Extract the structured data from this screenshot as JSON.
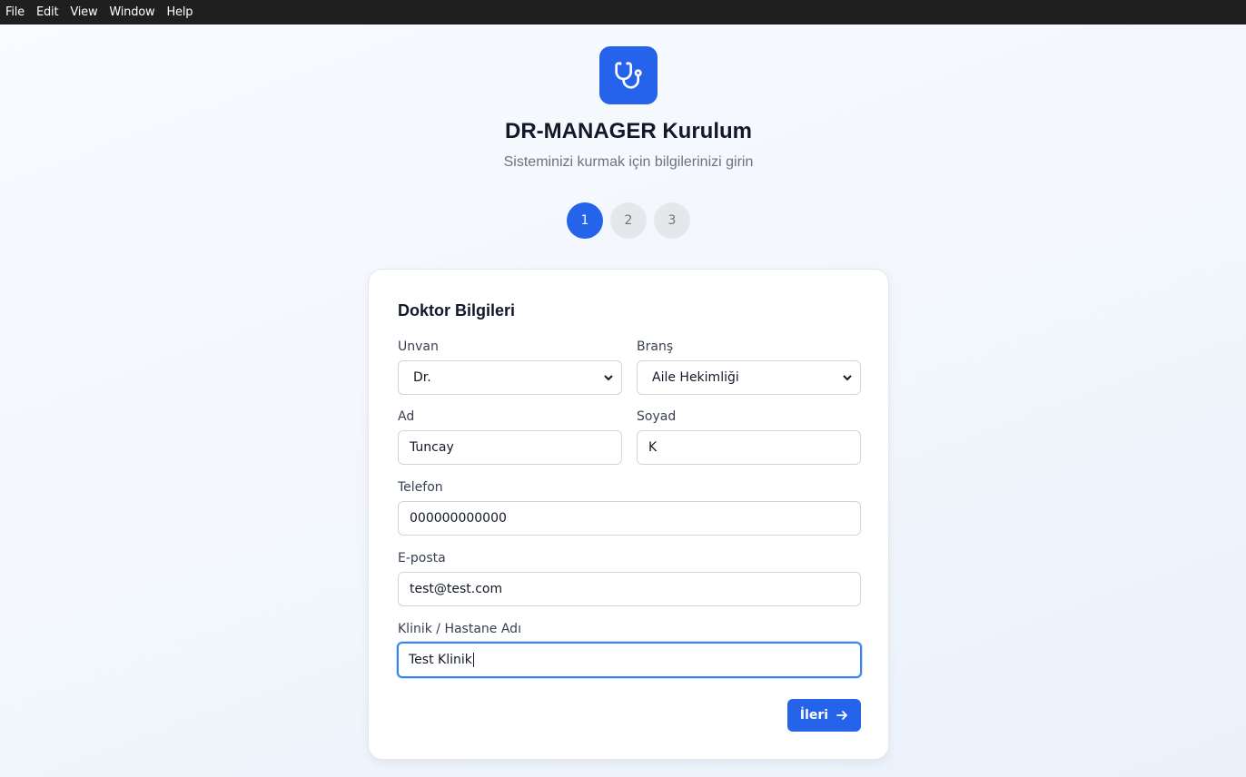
{
  "menubar": {
    "items": [
      "File",
      "Edit",
      "View",
      "Window",
      "Help"
    ]
  },
  "header": {
    "logo_icon": "stethoscope-icon",
    "title": "DR-MANAGER Kurulum",
    "subtitle": "Sisteminizi kurmak için bilgilerinizi girin"
  },
  "steps": {
    "items": [
      "1",
      "2",
      "3"
    ],
    "active_index": 0
  },
  "form": {
    "title": "Doktor Bilgileri",
    "unvan": {
      "label": "Unvan",
      "value": "Dr."
    },
    "brans": {
      "label": "Branş",
      "value": "Aile Hekimliği"
    },
    "ad": {
      "label": "Ad",
      "value": "Tuncay"
    },
    "soyad": {
      "label": "Soyad",
      "value": "K"
    },
    "telefon": {
      "label": "Telefon",
      "value": "000000000000"
    },
    "eposta": {
      "label": "E-posta",
      "value": "test@test.com"
    },
    "klinik": {
      "label": "Klinik / Hastane Adı",
      "value": "Test Klinik"
    },
    "next_label": "İleri"
  },
  "colors": {
    "accent": "#2563eb",
    "focus": "#3b82f6",
    "step_inactive": "#e5e7eb"
  }
}
